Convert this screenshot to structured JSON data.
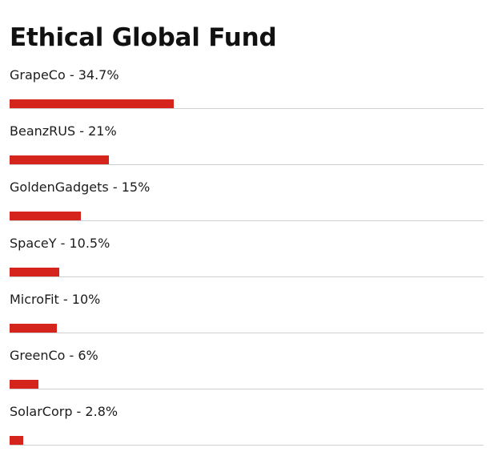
{
  "title": "Ethical Global Fund",
  "accent_color": "#d4241b",
  "holdings": [
    {
      "name": "GrapeCo",
      "percent": "34.7%",
      "value": 34.7
    },
    {
      "name": "BeanzRUS",
      "percent": "21%",
      "value": 21
    },
    {
      "name": "GoldenGadgets",
      "percent": "15%",
      "value": 15
    },
    {
      "name": "SpaceY",
      "percent": "10.5%",
      "value": 10.5
    },
    {
      "name": "MicroFit",
      "percent": "10%",
      "value": 10
    },
    {
      "name": "GreenCo",
      "percent": "6%",
      "value": 6
    },
    {
      "name": "SolarCorp",
      "percent": "2.8%",
      "value": 2.8
    }
  ]
}
